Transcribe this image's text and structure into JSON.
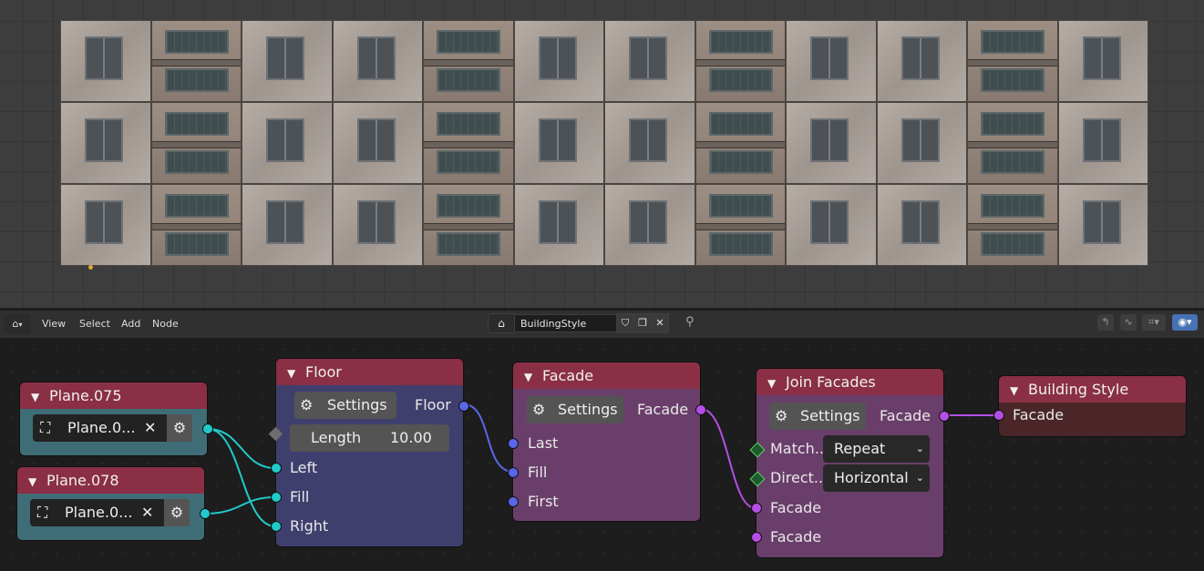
{
  "header": {
    "menu": [
      "View",
      "Select",
      "Add",
      "Node"
    ],
    "node_tree_name": "BuildingStyle"
  },
  "nodes": {
    "plane075": {
      "title": "Plane.075",
      "object": "Plane.0..."
    },
    "plane078": {
      "title": "Plane.078",
      "object": "Plane.0..."
    },
    "floor": {
      "title": "Floor",
      "settings": "Settings",
      "output": "Floor",
      "length_label": "Length",
      "length_value": "10.00",
      "inputs": [
        "Left",
        "Fill",
        "Right"
      ]
    },
    "facade": {
      "title": "Facade",
      "settings": "Settings",
      "output": "Facade",
      "inputs": [
        "Last",
        "Fill",
        "First"
      ]
    },
    "join": {
      "title": "Join Facades",
      "settings": "Settings",
      "output": "Facade",
      "match_label": "Match...",
      "match_value": "Repeat",
      "direction_label": "Direct...",
      "direction_value": "Horizontal",
      "inputs": [
        "Facade",
        "Facade"
      ]
    },
    "style": {
      "title": "Building Style",
      "input": "Facade"
    }
  },
  "colors": {
    "object_header": "#8a2f45",
    "object_body": "#3f6d77",
    "floor_body": "#3f3f6e",
    "facade_body": "#6a3e6a",
    "style_body": "#4a2628",
    "socket_object": "#21c9c9",
    "socket_floor": "#5a66e8",
    "socket_facade": "#b54ee6"
  },
  "icons": [
    "home-icon",
    "gear-icon",
    "close-icon",
    "shield-icon",
    "copy-icon",
    "pin-icon",
    "object-icon",
    "chevron-down-icon"
  ]
}
